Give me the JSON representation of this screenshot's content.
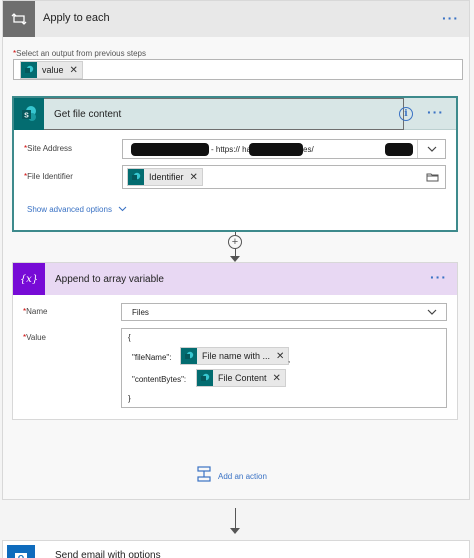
{
  "apply_to_each": {
    "title": "Apply to each",
    "select_label": "Select an output from previous steps",
    "value_token": "value",
    "required_marker": "*"
  },
  "get_file_content": {
    "title": "Get file content",
    "site_address_label": "Site Address",
    "site_address_value": "- https://                    harepoint.com/sites/",
    "file_identifier_label": "File Identifier",
    "file_identifier_token": "Identifier",
    "show_advanced": "Show advanced options",
    "info_glyph": "i"
  },
  "append_to_array": {
    "title": "Append to array variable",
    "icon_text": "{x}",
    "name_label": "Name",
    "name_value": "Files",
    "value_label": "Value",
    "json_open": "{",
    "filename_key": "\"fileName\":",
    "filename_token": "File name with ...",
    "comma": ",",
    "contentbytes_key": "\"contentBytes\":",
    "contentbytes_token": "File Content",
    "json_close": "}"
  },
  "add_action": {
    "label": "Add an action"
  },
  "send_email": {
    "title": "Send email with options"
  },
  "colors": {
    "sharepoint": "#036c70",
    "variable": "#770bd6",
    "link": "#3a72c4",
    "required": "#cc0000"
  },
  "icons": {
    "loop": "loop-icon",
    "sharepoint": "sharepoint-icon",
    "variable": "variable-icon",
    "outlook": "outlook-icon",
    "info": "info-icon",
    "more": "more-icon",
    "close": "close-icon",
    "chevron": "chevron-down-icon",
    "folder": "folder-icon",
    "add": "add-action-icon"
  }
}
